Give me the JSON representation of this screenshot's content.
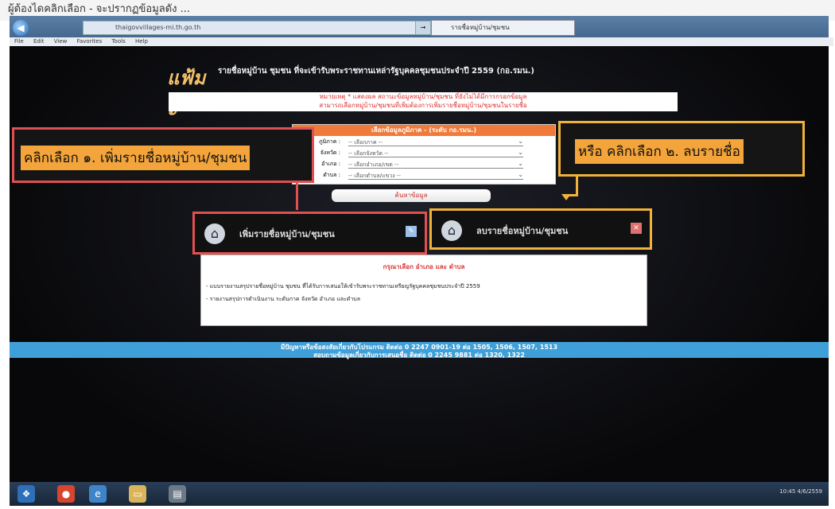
{
  "doc_caption": "ผู้ต้องไดคลิกเลือก - จะปรากฏข้อมูลดัง ...",
  "browser": {
    "address": "thaigovvillages-mi.th.go.th",
    "go_label": "→",
    "tab_label": "รายชื่อหมู่บ้าน/ชุมชน",
    "menu": [
      "File",
      "Edit",
      "View",
      "Favorites",
      "Tools",
      "Help"
    ]
  },
  "site": {
    "logo": "แฟ้มะ",
    "logo_small": "หมู่บ้านภาคใต้",
    "title": "รายชื่อหมู่บ้าน ชุมชน ที่จะเข้ารับพระราชทานเหล่ารัฐบุคคลชุมชนประจำปี 2559 (กอ.รมน.)",
    "notice_line1": "หมายเหตุ * แสดงผล สถานะข้อมูลหมู่บ้าน/ชุมชน ที่ยังไม่ได้มีการกรอกข้อมูล",
    "notice_line2": "สามารถเลือกหมู่บ้าน/ชุมชนที่เพิ่มต้องการเพิ่มรายชื่อหมู่บ้าน/ชุมชนในรายชื่อ"
  },
  "filter": {
    "header": "เลือกข้อมูลภูมิภาค - (ระดับ กอ.รมน.)",
    "rows": [
      {
        "label": "ภูมิภาค :",
        "value": "-- เลือกภาค --"
      },
      {
        "label": "จังหวัด :",
        "value": "-- เลือกจังหวัด --"
      },
      {
        "label": "อำเภอ :",
        "value": "-- เลือกอำเภอ/เขต --"
      },
      {
        "label": "ตำบล :",
        "value": "-- เลือกตำบล/แขวง --"
      }
    ],
    "search_label": "ค้นหาข้อมูล"
  },
  "annotations": {
    "add": "คลิกเลือก ๑. เพิ่มรายชื่อหมู่บ้าน/ชุมชน",
    "delete": "หรือ คลิกเลือก ๒. ลบรายชื่อ"
  },
  "actions": {
    "add_label": "เพิ่มรายชื่อหมู่บ้าน/ชุมชน",
    "delete_label": "ลบรายชื่อหมู่บ้าน/ชุมชน"
  },
  "info": {
    "title": "กรุณาเลือก อำเภอ และ ตำบล",
    "line1": "- แบบรายงานสรุปรายชื่อหมู่บ้าน ชุมชน ที่ได้รับการเสนอให้เข้ารับพระราชทานเหรียญรัฐบุคคลชุมชนประจำปี 2559",
    "line2": "- รายงานสรุปการดำเนินงาน ระดับภาค จังหวัด อำเภอ และตำบล"
  },
  "footer": {
    "line1": "มีปัญหาหรือข้อสงสัยเกี่ยวกับโปรแกรม ติดต่อ 0 2247 0901-19 ต่อ 1505, 1506, 1507, 1513",
    "line2": "สอบถามข้อมูลเกี่ยวกับการเสนอชื่อ ติดต่อ 0 2245 9881 ต่อ 1320, 1322"
  },
  "taskbar": {
    "clock": "10:45 4/6/2559"
  }
}
